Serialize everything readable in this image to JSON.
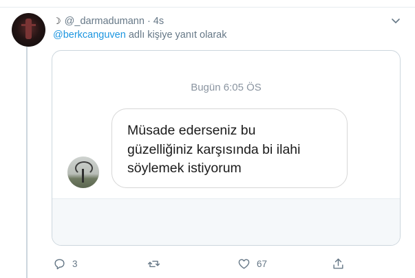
{
  "tweet": {
    "username": "@_darmadumann",
    "separator": "·",
    "time": "4s",
    "reply_to_mention": "@berkcanguven",
    "reply_to_suffix": "adlı kişiye yanıt olarak"
  },
  "screenshot_card": {
    "timestamp": "Bugün 6:05 ÖS",
    "message_lines": [
      "Müsade ederseniz bu",
      "güzelliğiniz karşısında bi ilahi",
      "söylemek istiyorum"
    ]
  },
  "actions": {
    "reply_count": "3",
    "retweet_count": "",
    "like_count": "67",
    "icons": [
      "reply-icon",
      "retweet-icon",
      "like-icon",
      "share-icon"
    ]
  },
  "colors": {
    "link": "#1b95e0",
    "secondary_text": "#657786",
    "border": "#ccd6dd"
  }
}
